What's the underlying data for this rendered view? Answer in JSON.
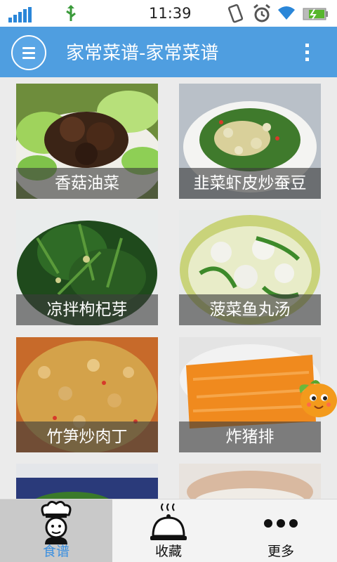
{
  "status_bar": {
    "time": "11:39"
  },
  "header": {
    "title": "家常菜谱-家常菜谱"
  },
  "recipes": [
    {
      "name": "香菇油菜"
    },
    {
      "name": "韭菜虾皮炒蚕豆"
    },
    {
      "name": "凉拌枸杞芽"
    },
    {
      "name": "菠菜鱼丸汤"
    },
    {
      "name": "竹笋炒肉丁"
    },
    {
      "name": "炸猪排"
    },
    {
      "name": ""
    },
    {
      "name": ""
    }
  ],
  "bottom_nav": {
    "tabs": [
      {
        "label": "食谱",
        "icon": "chef-icon",
        "active": true
      },
      {
        "label": "收藏",
        "icon": "cloche-icon",
        "active": false
      },
      {
        "label": "更多",
        "icon": "more-dots-icon",
        "active": false
      }
    ]
  },
  "colors": {
    "accent": "#4f9ee0",
    "active_tab_text": "#3a8fe0"
  }
}
